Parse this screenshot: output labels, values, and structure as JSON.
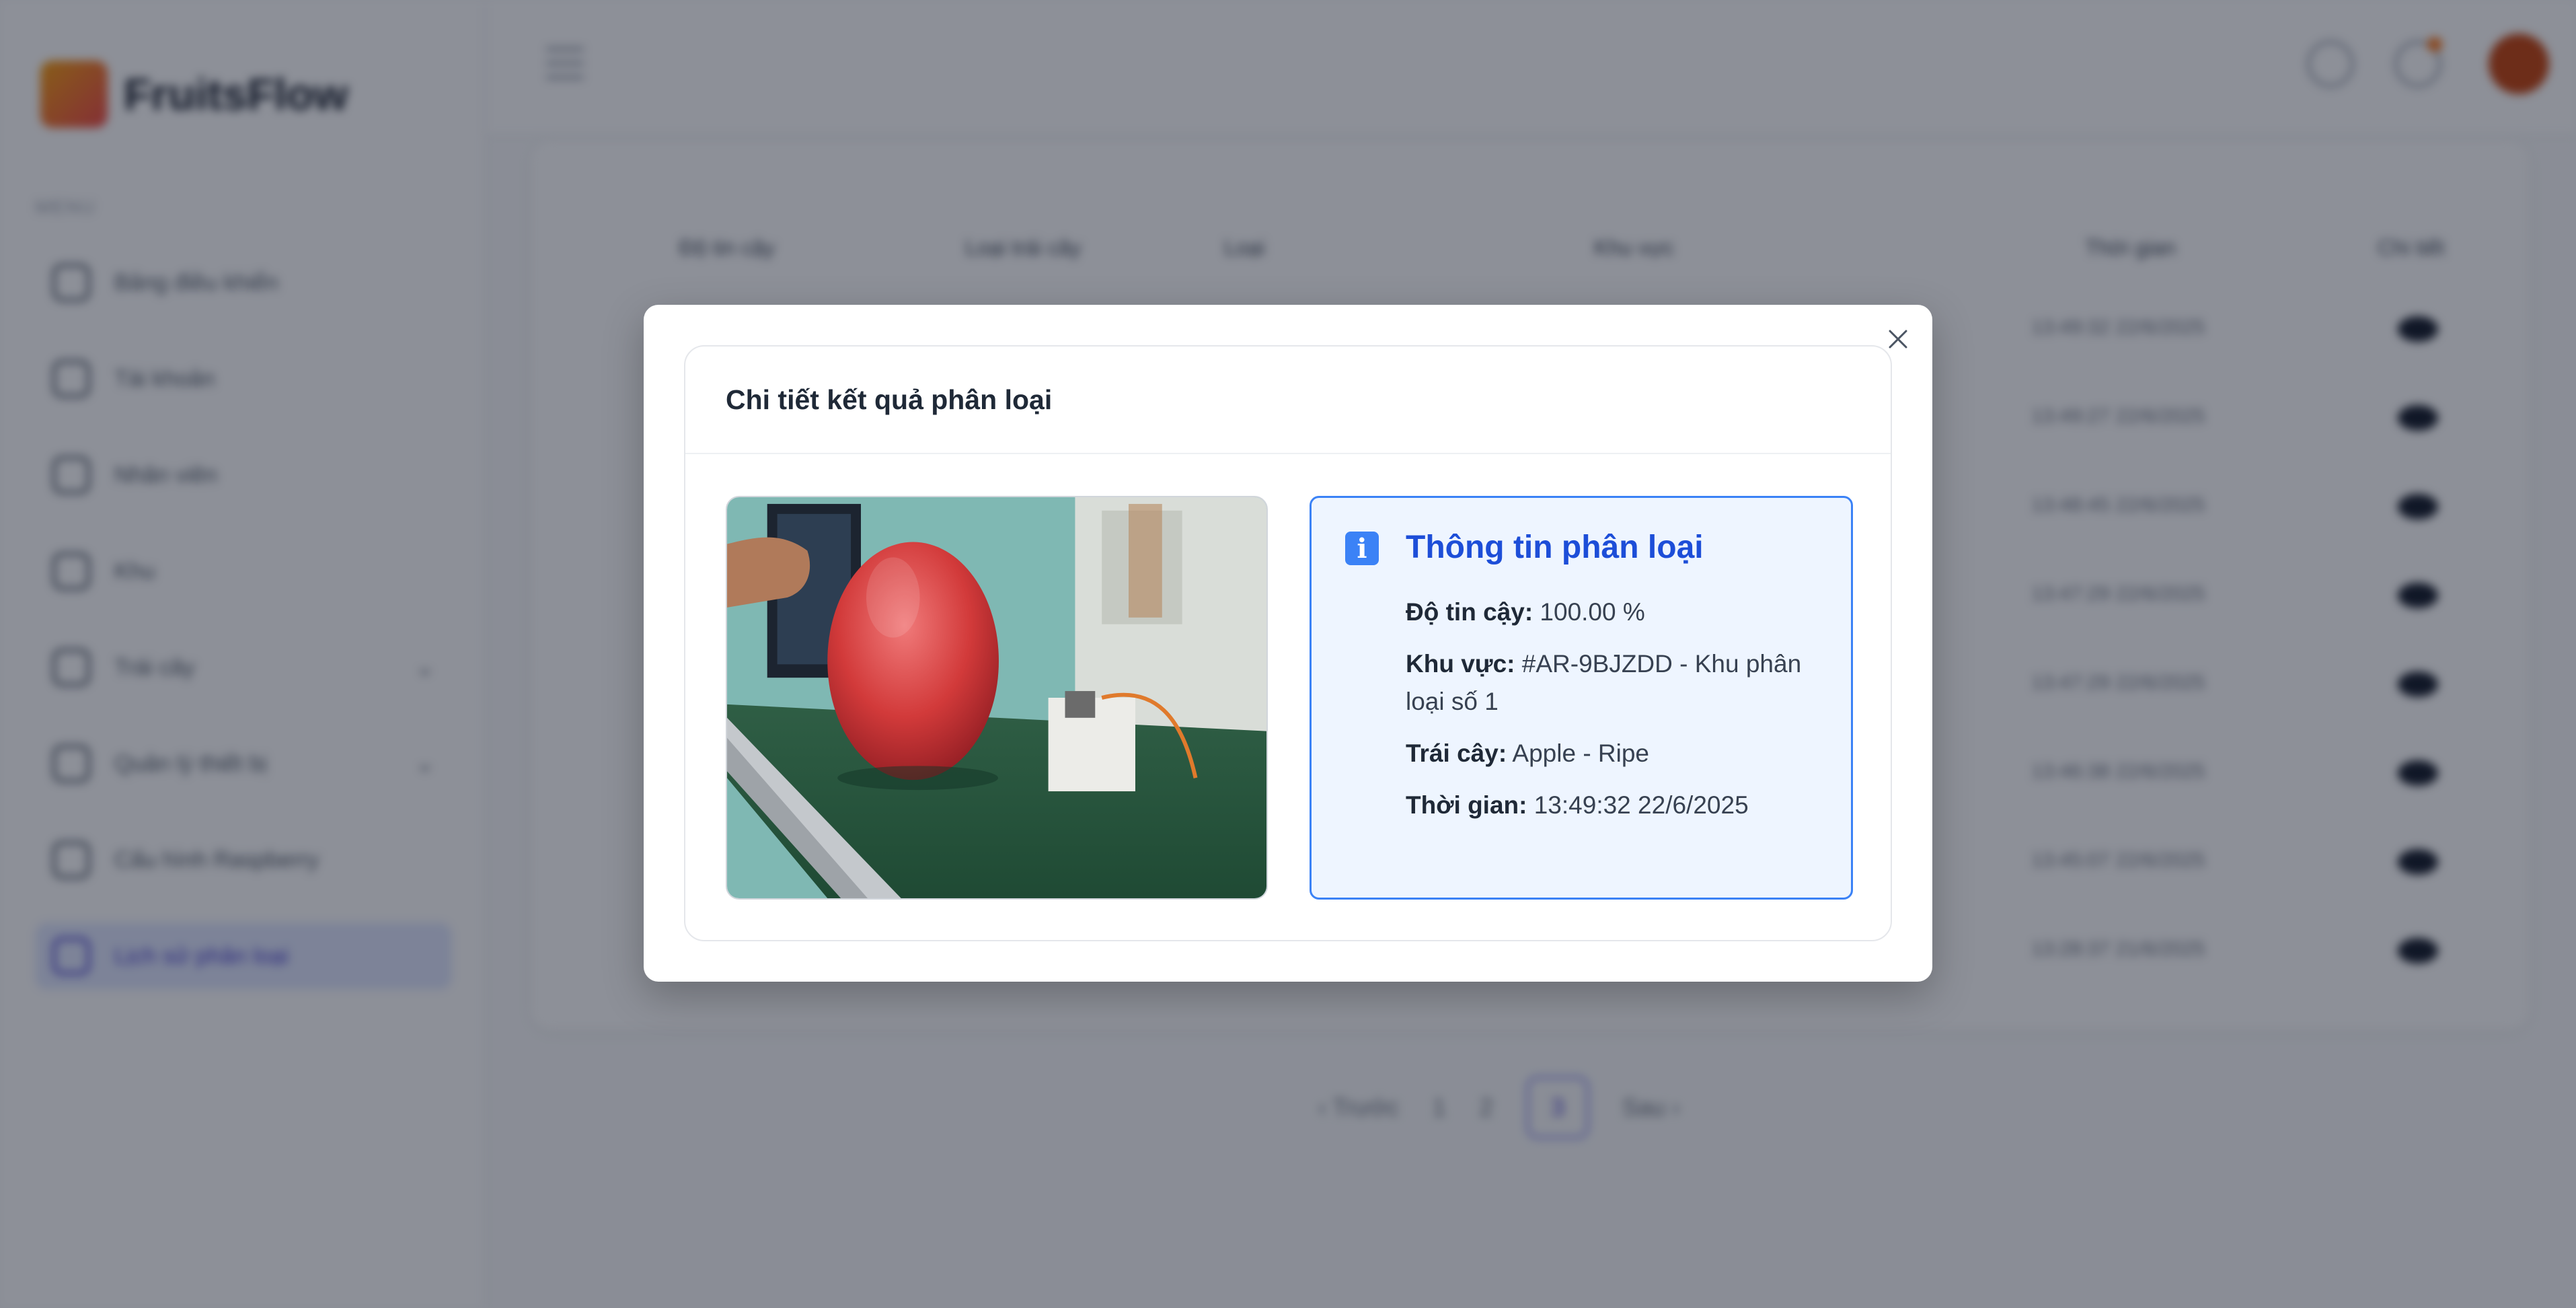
{
  "brand": {
    "name": "FruitsFlow"
  },
  "sidebar": {
    "menu_title": "MENU",
    "items": [
      {
        "label": "Bảng điều khiển",
        "icon": "dashboard-icon"
      },
      {
        "label": "Tài khoản",
        "icon": "account-icon"
      },
      {
        "label": "Nhân viên",
        "icon": "staff-icon"
      },
      {
        "label": "Khu",
        "icon": "area-icon"
      },
      {
        "label": "Trái cây",
        "icon": "fruit-icon"
      },
      {
        "label": "Quản lý thiết bị",
        "icon": "device-icon"
      },
      {
        "label": "Cấu hình Raspberry",
        "icon": "raspberry-icon"
      },
      {
        "label": "Lịch sử phân loại",
        "icon": "history-icon"
      }
    ]
  },
  "table": {
    "headers": [
      "Độ tin cậy",
      "Loại trái cây",
      "Loại",
      "Khu vực",
      "Thời gian",
      "Chi tiết"
    ],
    "times": [
      "13:49:32 22/6/2025",
      "13:49:27 22/6/2025",
      "13:48:45 22/6/2025",
      "13:47:29 22/6/2025",
      "13:47:29 22/6/2025",
      "13:46:38 22/6/2025",
      "13:45:07 22/6/2025",
      "13:28:37 21/6/2025"
    ]
  },
  "pagination": {
    "prev": "‹ Trước",
    "pages": [
      "1",
      "2",
      "3"
    ],
    "next": "Sau ›"
  },
  "modal": {
    "title": "Chi tiết kết quả phân loại",
    "info": {
      "title": "Thông tin phân loại",
      "confidence_label": "Độ tin cậy:",
      "confidence_value": "100.00 %",
      "area_label": "Khu vực:",
      "area_value": "#AR-9BJZDD - Khu phân loại số 1",
      "fruit_label": "Trái cây:",
      "fruit_value": "Apple - Ripe",
      "time_label": "Thời gian:",
      "time_value": "13:49:32 22/6/2025"
    }
  },
  "colors": {
    "accent": "#1d4ed8",
    "info_bg": "#eef5ff",
    "info_border": "#3b82f6"
  }
}
